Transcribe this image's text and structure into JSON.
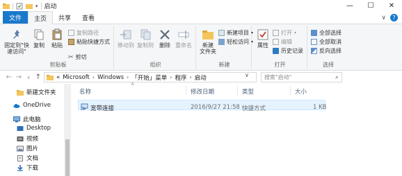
{
  "window": {
    "title": "启动",
    "buttons": {
      "minimize": "—",
      "maximize": "☐",
      "close": "✕"
    }
  },
  "tabs": [
    {
      "label": "文件"
    },
    {
      "label": "主页"
    },
    {
      "label": "共享"
    },
    {
      "label": "查看"
    }
  ],
  "ribbon": {
    "clipboard": {
      "pin_label": "固定到\"快\n速访问\"",
      "copy_label": "复制",
      "paste_label": "粘贴",
      "copy_path_label": "复制路径",
      "paste_shortcut_label": "粘贴快捷方式",
      "cut_label": "剪切",
      "group_label": "剪贴板"
    },
    "organize": {
      "move_to_label": "移动到",
      "copy_to_label": "复制到",
      "delete_label": "删除",
      "rename_label": "重命名",
      "group_label": "组织"
    },
    "new": {
      "new_folder_label": "新建\n文件夹",
      "new_item_label": "新建项目",
      "easy_access_label": "轻松访问",
      "group_label": "新建"
    },
    "open": {
      "properties_label": "属性",
      "open_label": "打开",
      "edit_label": "编辑",
      "history_label": "历史记录",
      "group_label": "打开"
    },
    "select": {
      "select_all_label": "全部选择",
      "select_none_label": "全部取消",
      "invert_label": "反向选择",
      "group_label": "选择"
    }
  },
  "address": {
    "prefix": "«",
    "crumbs": [
      "Microsoft",
      "Windows",
      "「开始」菜单",
      "程序",
      "启动"
    ],
    "separator": "›",
    "search_placeholder": "搜索\"启动\""
  },
  "navpane": {
    "items": [
      {
        "label": "新建文件夹",
        "icon": "folder-icon"
      },
      {
        "label": "OneDrive",
        "icon": "cloud-icon"
      },
      {
        "label": "此电脑",
        "icon": "computer-icon"
      },
      {
        "label": "Desktop",
        "icon": "desktop-icon"
      },
      {
        "label": "视频",
        "icon": "video-icon"
      },
      {
        "label": "图片",
        "icon": "picture-icon"
      },
      {
        "label": "文档",
        "icon": "document-icon"
      },
      {
        "label": "下载",
        "icon": "download-icon"
      }
    ]
  },
  "filelist": {
    "columns": {
      "name": "名称",
      "modified": "修改日期",
      "type": "类型",
      "size": "大小"
    },
    "rows": [
      {
        "name": "宽带连接",
        "modified": "2016/9/27 21:58",
        "type": "快捷方式",
        "size": "1 KB"
      }
    ]
  },
  "colors": {
    "accent": "#1979ca",
    "selection": "#e5f3ff",
    "folder": "#f3c55b"
  }
}
